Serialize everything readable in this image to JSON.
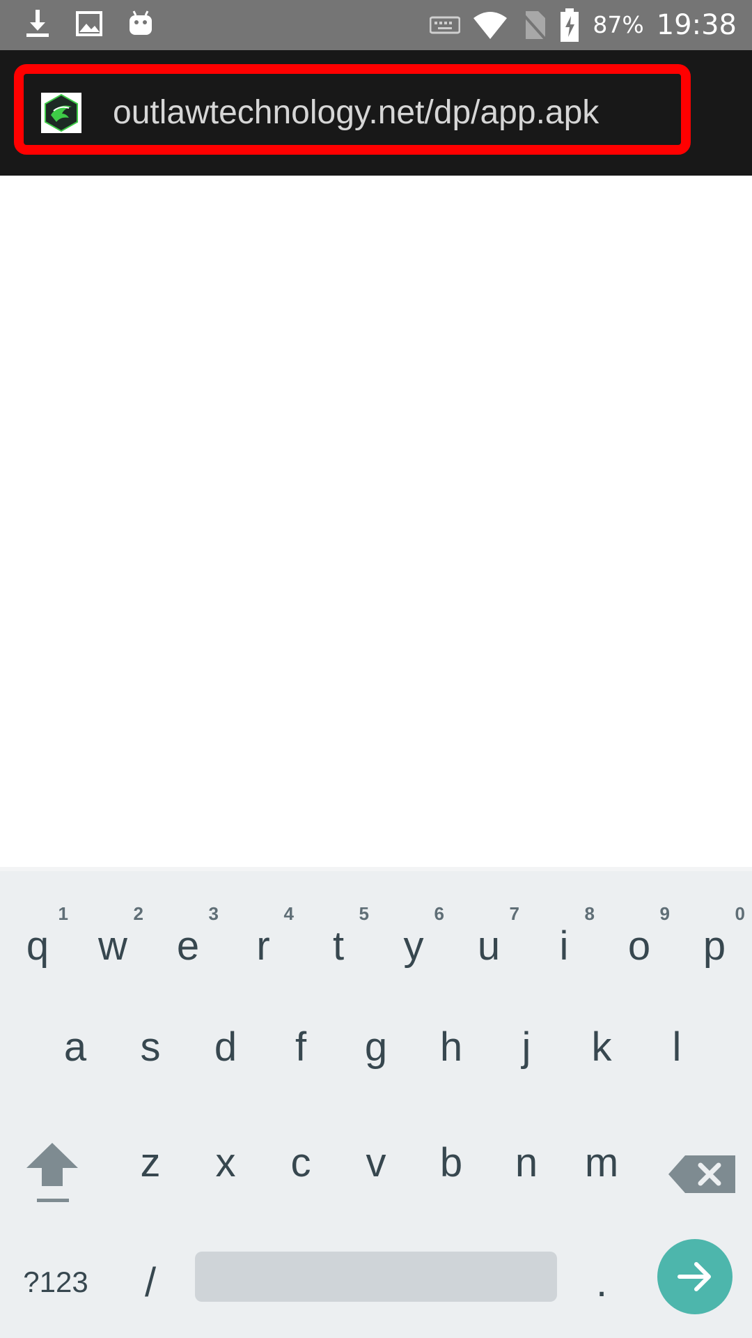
{
  "status_bar": {
    "left_icons": [
      "download-icon",
      "image-icon",
      "android-icon"
    ],
    "right_icons": [
      "keyboard-icon",
      "wifi-icon",
      "no-sim-icon",
      "battery-charging-icon"
    ],
    "battery_percent": "87%",
    "time": "19:38"
  },
  "url_bar": {
    "favicon": "outlaw-technology-favicon",
    "url": "outlawtechnology.net/dp/app.apk",
    "highlight_color": "#ff0000"
  },
  "keyboard": {
    "row1": [
      {
        "key": "q",
        "hint": "1"
      },
      {
        "key": "w",
        "hint": "2"
      },
      {
        "key": "e",
        "hint": "3"
      },
      {
        "key": "r",
        "hint": "4"
      },
      {
        "key": "t",
        "hint": "5"
      },
      {
        "key": "y",
        "hint": "6"
      },
      {
        "key": "u",
        "hint": "7"
      },
      {
        "key": "i",
        "hint": "8"
      },
      {
        "key": "o",
        "hint": "9"
      },
      {
        "key": "p",
        "hint": "0"
      }
    ],
    "row2": [
      "a",
      "s",
      "d",
      "f",
      "g",
      "h",
      "j",
      "k",
      "l"
    ],
    "row3": [
      "z",
      "x",
      "c",
      "v",
      "b",
      "n",
      "m"
    ],
    "symbols_label": "?123",
    "slash_label": "/",
    "period_label": ".",
    "action_icon": "arrow-right-icon",
    "action_color": "#4db6ac"
  }
}
